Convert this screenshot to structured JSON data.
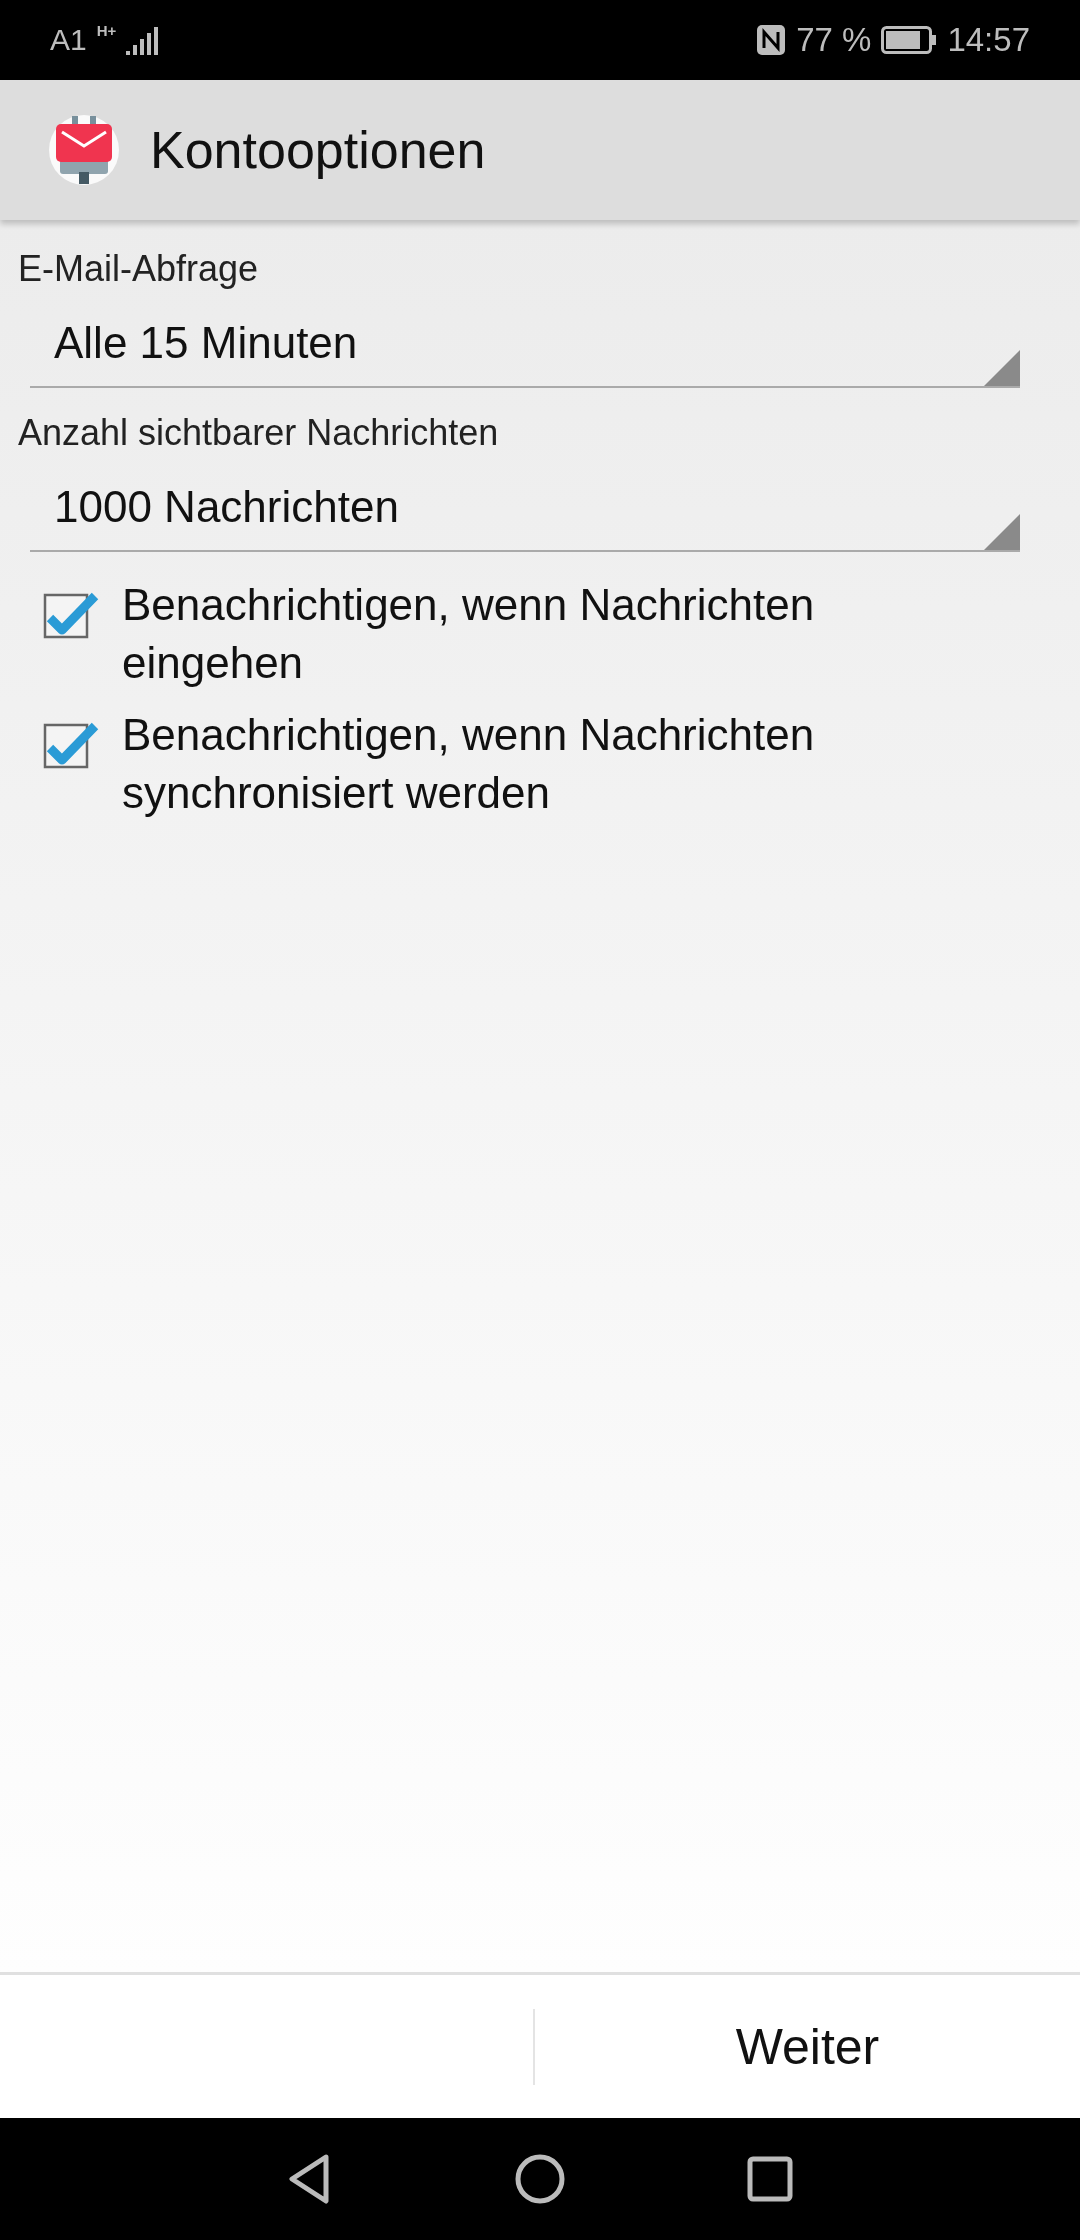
{
  "status_bar": {
    "carrier": "A1",
    "network": "H+",
    "battery_percent": "77 %",
    "time": "14:57"
  },
  "app_bar": {
    "title": "Kontooptionen"
  },
  "settings": [
    {
      "kind": "spinner",
      "label": "E-Mail-Abfrage",
      "value": "Alle 15 Minuten"
    },
    {
      "kind": "spinner",
      "label": "Anzahl sichtbarer Nachrichten",
      "value": "1000 Nachrichten"
    },
    {
      "kind": "checkbox",
      "label": "Benachrichtigen, wenn Nachrichten eingehen",
      "checked": true
    },
    {
      "kind": "checkbox",
      "label": "Benachrichtigen, wenn Nachrichten synchronisiert werden",
      "checked": true
    }
  ],
  "footer": {
    "next_button": "Weiter"
  }
}
